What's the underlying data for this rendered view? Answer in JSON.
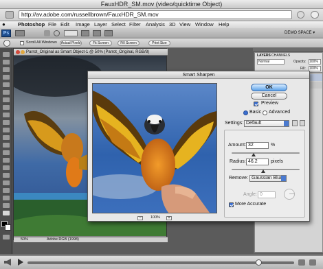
{
  "window": {
    "title": "FauxHDR_SM.mov (video/quicktime Object)"
  },
  "address_bar": {
    "url": "http://av.adobe.com/russellbrown/FauxHDR_SM.mov"
  },
  "menubar": {
    "app_name": "Photoshop",
    "items": [
      "File",
      "Edit",
      "Image",
      "Layer",
      "Select",
      "Filter",
      "Analysis",
      "3D",
      "View",
      "Window",
      "Help"
    ]
  },
  "app_bar": {
    "workspace": "DEMO SPACE ▾"
  },
  "options_bar": {
    "scroll_all": "Scroll All Windows",
    "buttons": [
      "Actual Pixels",
      "Fit Screen",
      "Fill Screen",
      "Print Size"
    ]
  },
  "document": {
    "title": "Parrot_Original as Smart Object-1 @ 50% (Parrot_Original, RGB/8)",
    "zoom": "50%",
    "profile": "Adobe RGB (1998)"
  },
  "layers_panel": {
    "tabs": [
      "LAYERS",
      "CHANNELS"
    ],
    "blend_mode": "Normal",
    "opacity_label": "Opacity:",
    "opacity_value": "100%",
    "fill_label": "Fill:",
    "fill_value": "100%"
  },
  "dialog": {
    "title": "Smart Sharpen",
    "ok": "OK",
    "cancel": "Cancel",
    "preview_label": "Preview",
    "mode_basic": "Basic",
    "mode_advanced": "Advanced",
    "settings_label": "Settings:",
    "settings_value": "Default",
    "amount_label": "Amount:",
    "amount_value": "32",
    "amount_unit": "%",
    "radius_label": "Radius:",
    "radius_value": "46.2",
    "radius_unit": "pixels",
    "remove_label": "Remove:",
    "remove_value": "Gaussian Blur",
    "angle_label": "Angle:",
    "angle_value": "0",
    "more_accurate_label": "More Accurate",
    "zoom": "100%",
    "amount_fraction": 0.32,
    "radius_fraction": 0.46
  }
}
